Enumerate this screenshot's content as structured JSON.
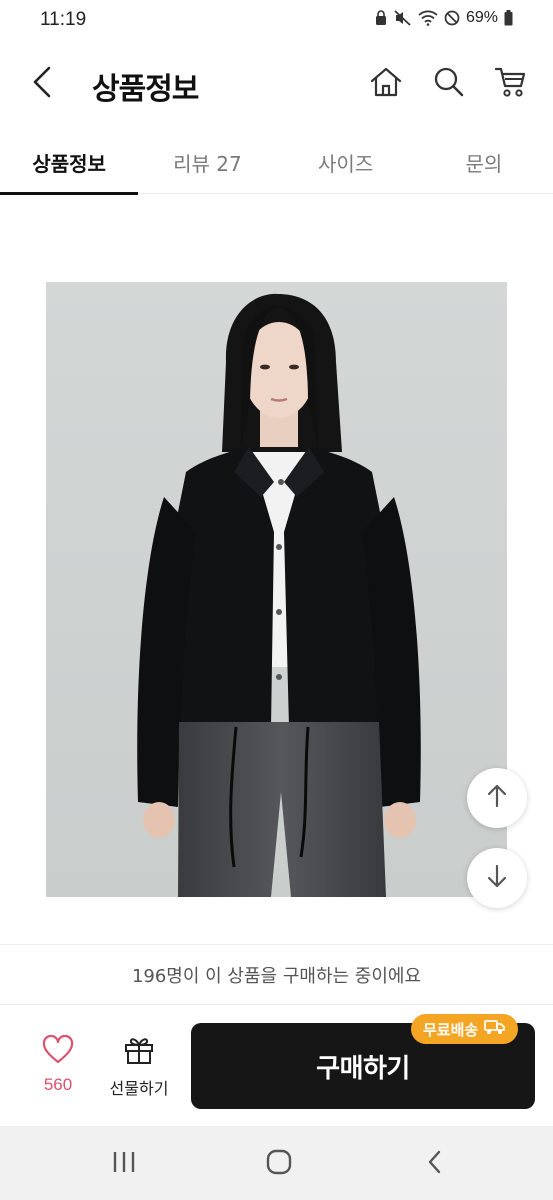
{
  "status_bar": {
    "time": "11:19",
    "battery": "69%"
  },
  "header": {
    "title": "상품정보"
  },
  "tabs": [
    {
      "label": "상품정보"
    },
    {
      "label": "리뷰 27"
    },
    {
      "label": "사이즈"
    },
    {
      "label": "문의"
    }
  ],
  "notice": {
    "text": "196명이 이 상품을 구매하는 중이에요"
  },
  "bottom_bar": {
    "like_count": "560",
    "gift_label": "선물하기",
    "buy_label": "구매하기",
    "free_shipping_badge": "무료배송"
  },
  "colors": {
    "accent_pink": "#e0506b",
    "badge_orange": "#f5a524",
    "buy_button": "#161616"
  },
  "icons": {
    "back": "chevron-left-icon",
    "home": "home-icon",
    "search": "search-icon",
    "cart": "cart-icon",
    "like": "heart-icon",
    "gift": "gift-icon",
    "truck": "truck-icon",
    "scroll_up": "arrow-up-icon",
    "scroll_down": "arrow-down-icon"
  }
}
